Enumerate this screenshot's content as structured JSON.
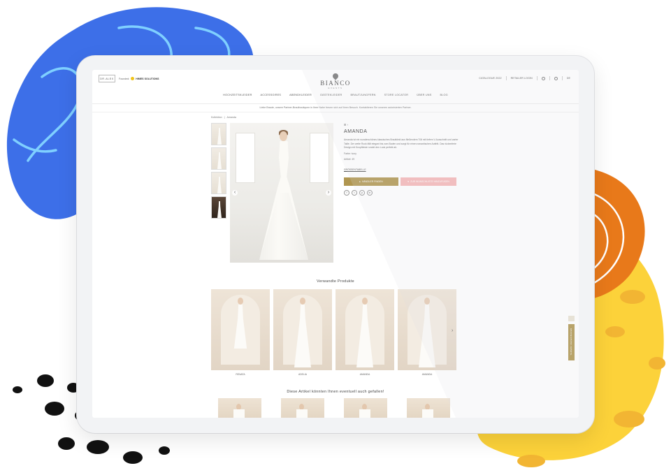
{
  "header": {
    "brand_box": "DR.ALEX",
    "partner_prefix": "Founded:",
    "partner_name": "HIMES SOLUTIONS",
    "logo_name": "BIANCO",
    "logo_sub": "EVENTS",
    "right_links": [
      "CATALOGUE 2022",
      "RETAILER LOGIN",
      "DE"
    ]
  },
  "nav": {
    "items": [
      "HOCHZEITSKLEIDER",
      "ACCESSOIRES",
      "ABENDKLEIDER",
      "GÄSTEKLEIDER",
      "BRAUTJUNGFERN",
      "STORE LOCATOR",
      "ÜBER UNS",
      "BLOG"
    ]
  },
  "notice": "Liebe Braute, unsere Partner-Brautboutiquen in Ihrer Nahe freuen sich auf Ihren Besuch. Kontaktieren Sie unseren autorisierten Partner.",
  "breadcrumb": [
    "Kollektion",
    "Amanda"
  ],
  "product": {
    "meta_icons": "⊞ ›",
    "title": "AMANDA",
    "description": "Amanda ist ein wunderschönes klassisches Brautkleid aus fließendem Tüll mit tiefem V-Ausschnitt und zarter Taille. Der weite Rock fällt elegant bis zum Boden und sorgt für einen romantischen Auftritt. Das rückenfreie Design mit Knopfleiste rundet den Look perfekt ab.",
    "spec_color": "Farbe: ivory",
    "spec_article": "Artikel: 49",
    "size_link": "GRÖSSENTABELLE",
    "shop_button": "HÄNDLER FINDEN",
    "fav_button": "ZUR WUNSCHLISTE HINZUFÜGEN",
    "socials": [
      "f",
      "t",
      "p",
      "in"
    ]
  },
  "related": {
    "title": "Verwandte Produkte",
    "items": [
      "RENATA",
      "ADELIA",
      "AMANDA",
      "AMANDA"
    ]
  },
  "maybe": {
    "title": "Diese Artikel könnten Ihnen eventuell auch gefallen!"
  },
  "side_tab": "TERMIN VEREINBAREN",
  "colors": {
    "blob_blue": "#3d6fe8",
    "blob_orange": "#e8791a",
    "blob_yellow": "#fcd23a",
    "accent_gold": "#b09650",
    "accent_pink": "#f6b8b8"
  }
}
